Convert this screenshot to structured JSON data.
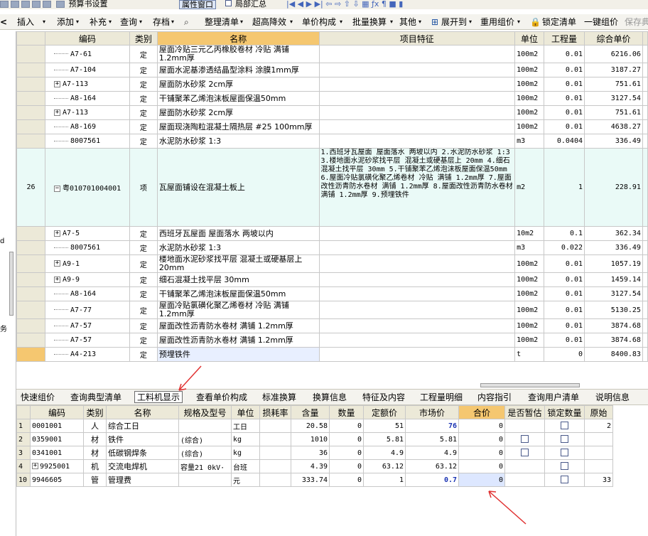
{
  "toolbar1": {
    "preview": "预算书设置",
    "attr_window": "属性窗口",
    "partial_summary": "局部汇总"
  },
  "toolbar2": {
    "items": [
      "插入",
      "添加",
      "补充",
      "查询",
      "存档",
      "整理清单",
      "超高降效",
      "单价构成",
      "批量换算",
      "其他",
      "展开到",
      "重用组价",
      "锁定清单",
      "一键组价",
      "保存典"
    ]
  },
  "grid": {
    "headers": [
      "编码",
      "类别",
      "名称",
      "项目特征",
      "单位",
      "工程量",
      "综合单价"
    ],
    "rows": [
      {
        "n": "",
        "code": "A7-61",
        "type": "定",
        "name": "屋面冷贴三元乙丙橡胶卷材 冷贴 满铺 1.2mm厚",
        "feat": "",
        "unit": "100m2",
        "qty": "0.01",
        "price": "6216.06",
        "tree": "line"
      },
      {
        "n": "",
        "code": "A7-104",
        "type": "定",
        "name": "屋面水泥基渗透结晶型涂料 涂膜1mm厚",
        "feat": "",
        "unit": "100m2",
        "qty": "0.01",
        "price": "3187.27",
        "tree": "line"
      },
      {
        "n": "",
        "code": "A7-113",
        "type": "定",
        "name": "屋面防水砂浆 2cm厚",
        "feat": "",
        "unit": "100m2",
        "qty": "0.01",
        "price": "751.61",
        "tree": "plus"
      },
      {
        "n": "",
        "code": "A8-164",
        "type": "定",
        "name": "干铺聚苯乙烯泡沫板屋面保温50mm",
        "feat": "",
        "unit": "100m2",
        "qty": "0.01",
        "price": "3127.54",
        "tree": "line"
      },
      {
        "n": "",
        "code": "A7-113",
        "type": "定",
        "name": "屋面防水砂浆 2cm厚",
        "feat": "",
        "unit": "100m2",
        "qty": "0.01",
        "price": "751.61",
        "tree": "plus"
      },
      {
        "n": "",
        "code": "A8-169",
        "type": "定",
        "name": "屋面现浇陶粒混凝土隔热层 #25 100mm厚",
        "feat": "",
        "unit": "100m2",
        "qty": "0.01",
        "price": "4638.27",
        "tree": "line"
      },
      {
        "n": "",
        "code": "8007561",
        "type": "定",
        "name": "水泥防水砂浆 1:3",
        "feat": "",
        "unit": "m3",
        "qty": "0.0404",
        "price": "336.49",
        "tree": "line"
      },
      {
        "n": "26",
        "code": "粤010701004001",
        "type": "项",
        "name": "瓦屋面铺设在混凝土板上",
        "feat": "1.西班牙瓦屋面 屋面落水 两坡以内\n2.水泥防水砂浆 1:3\n3.楼地面水泥砂浆找平层 混凝土或硬基层上 20mm\n4.细石混凝土找平层 30mm\n5.干铺聚苯乙烯泡沫板屋面保温50mm\n6.屋面冷贴氯磺化聚乙烯卷材 冷贴 满铺 1.2mm厚\n7.屋面改性沥青防水卷材 满铺 1.2mm厚\n8.屋面改性沥青防水卷材 满铺 1.2mm厚\n9.预埋铁件",
        "unit": "m2",
        "qty": "1",
        "price": "228.91",
        "tree": "minus"
      },
      {
        "n": "",
        "code": "A7-5",
        "type": "定",
        "name": "西班牙瓦屋面 屋面落水 两坡以内",
        "feat": "",
        "unit": "10m2",
        "qty": "0.1",
        "price": "362.34",
        "tree": "plus"
      },
      {
        "n": "",
        "code": "8007561",
        "type": "定",
        "name": "水泥防水砂浆 1:3",
        "feat": "",
        "unit": "m3",
        "qty": "0.022",
        "price": "336.49",
        "tree": "line"
      },
      {
        "n": "",
        "code": "A9-1",
        "type": "定",
        "name": "楼地面水泥砂浆找平层 混凝土或硬基层上 20mm",
        "feat": "",
        "unit": "100m2",
        "qty": "0.01",
        "price": "1057.19",
        "tree": "plus"
      },
      {
        "n": "",
        "code": "A9-9",
        "type": "定",
        "name": "细石混凝土找平层 30mm",
        "feat": "",
        "unit": "100m2",
        "qty": "0.01",
        "price": "1459.14",
        "tree": "plus"
      },
      {
        "n": "",
        "code": "A8-164",
        "type": "定",
        "name": "干铺聚苯乙烯泡沫板屋面保温50mm",
        "feat": "",
        "unit": "100m2",
        "qty": "0.01",
        "price": "3127.54",
        "tree": "line"
      },
      {
        "n": "",
        "code": "A7-77",
        "type": "定",
        "name": "屋面冷贴氯磺化聚乙烯卷材 冷贴 满铺 1.2mm厚",
        "feat": "",
        "unit": "100m2",
        "qty": "0.01",
        "price": "5130.25",
        "tree": "line"
      },
      {
        "n": "",
        "code": "A7-57",
        "type": "定",
        "name": "屋面改性沥青防水卷材 满铺 1.2mm厚",
        "feat": "",
        "unit": "100m2",
        "qty": "0.01",
        "price": "3874.68",
        "tree": "line"
      },
      {
        "n": "",
        "code": "A7-57",
        "type": "定",
        "name": "屋面改性沥青防水卷材 满铺 1.2mm厚",
        "feat": "",
        "unit": "100m2",
        "qty": "0.01",
        "price": "3874.68",
        "tree": "line"
      },
      {
        "n": "",
        "code": "A4-213",
        "type": "定",
        "name": "预埋铁件",
        "feat": "",
        "unit": "t",
        "qty": "0",
        "price": "8400.83",
        "tree": "line"
      }
    ]
  },
  "tabs": {
    "items": [
      "快速组价",
      "查询典型清单",
      "工料机显示",
      "查看单价构成",
      "标准换算",
      "换算信息",
      "特征及内容",
      "工程量明细",
      "内容指引",
      "查询用户清单",
      "说明信息"
    ]
  },
  "bottom": {
    "headers": [
      "编码",
      "类别",
      "名称",
      "规格及型号",
      "单位",
      "损耗率",
      "含量",
      "数量",
      "定额价",
      "市场价",
      "合价",
      "是否暂估",
      "锁定数量",
      "原始"
    ],
    "rows": [
      {
        "n": "1",
        "code": "0001001",
        "type": "人",
        "name": "综合工日",
        "spec": "",
        "unit": "工日",
        "loss": "",
        "content": "20.58",
        "qty": "0",
        "quota": "51",
        "market": "76",
        "total": "0",
        "est": false,
        "lock": true,
        "orig": "2"
      },
      {
        "n": "2",
        "code": "0359001",
        "type": "材",
        "name": "铁件",
        "spec": "(综合)",
        "unit": "kg",
        "loss": "",
        "content": "1010",
        "qty": "0",
        "quota": "5.81",
        "market": "5.81",
        "total": "0",
        "est": true,
        "lock": true,
        "orig": ""
      },
      {
        "n": "3",
        "code": "0341001",
        "type": "材",
        "name": "低碳钢焊条",
        "spec": "(综合)",
        "unit": "kg",
        "loss": "",
        "content": "36",
        "qty": "0",
        "quota": "4.9",
        "market": "4.9",
        "total": "0",
        "est": true,
        "lock": true,
        "orig": ""
      },
      {
        "n": "4",
        "code": "9925001",
        "type": "机",
        "name": "交流电焊机",
        "spec": "容量21 0kV·",
        "unit": "台班",
        "loss": "",
        "content": "4.39",
        "qty": "0",
        "quota": "63.12",
        "market": "63.12",
        "total": "0",
        "est": false,
        "lock": true,
        "orig": ""
      },
      {
        "n": "10",
        "code": "9946605",
        "type": "管",
        "name": "管理费",
        "spec": "",
        "unit": "元",
        "loss": "",
        "content": "333.74",
        "qty": "0",
        "quota": "1",
        "market": "0.7",
        "total": "0",
        "est": false,
        "lock": true,
        "orig": "33"
      }
    ]
  }
}
